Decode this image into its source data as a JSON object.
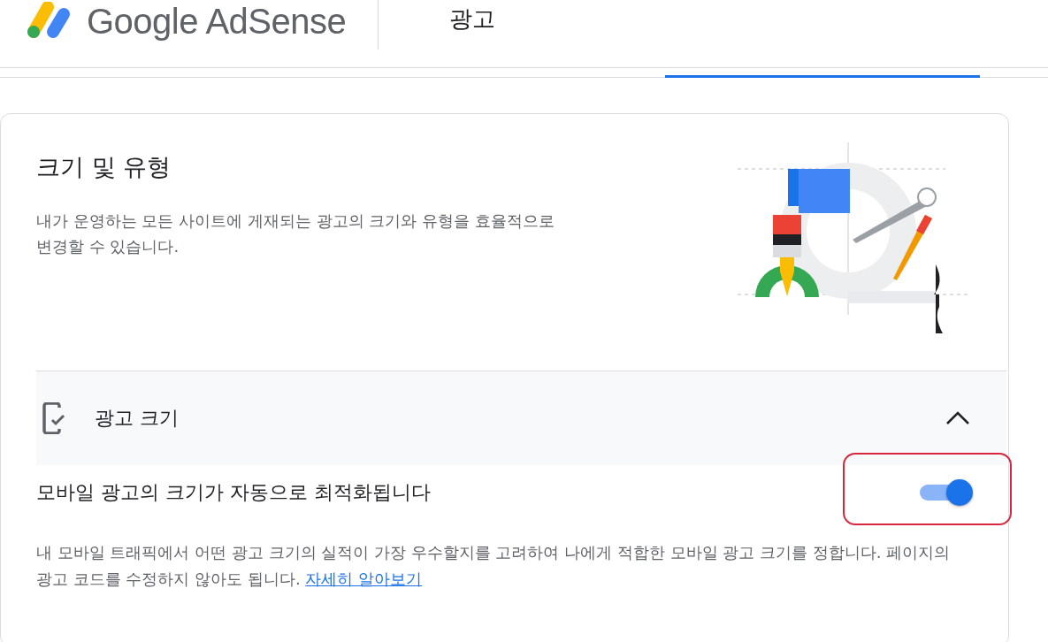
{
  "header": {
    "logo_text": "Google AdSense",
    "title": "광고"
  },
  "card": {
    "title": "크기 및 유형",
    "description": "내가 운영하는 모든 사이트에 게재되는 광고의 크기와 유형을 효율적으로 변경할 수 있습니다.",
    "section": {
      "label": "광고 크기",
      "expanded": true
    },
    "setting": {
      "label": "모바일 광고의 크기가 자동으로 최적화됩니다",
      "on": true,
      "description": "내 모바일 트래픽에서 어떤 광고 크기의 실적이 가장 우수할지를 고려하여 나에게 적합한 모바일 광고 크기를 정합니다. 페이지의 광고 코드를 수정하지 않아도 됩니다.",
      "link": "자세히 알아보기"
    }
  }
}
